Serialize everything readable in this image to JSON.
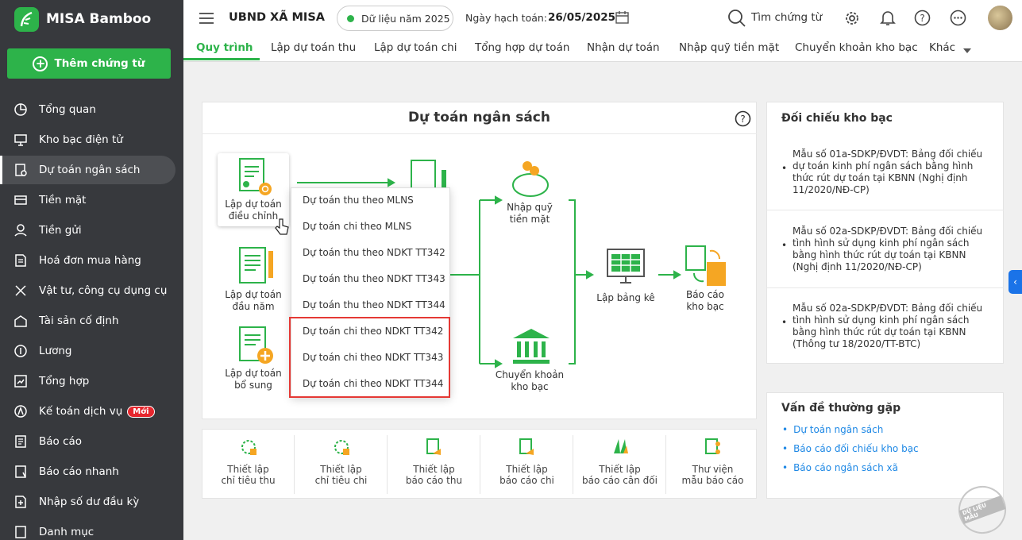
{
  "app": {
    "name": "MISA Bamboo",
    "add_label": "Thêm chứng từ"
  },
  "sidebar": {
    "items": [
      {
        "label": "Tổng quan",
        "icon": "chart-icon"
      },
      {
        "label": "Kho bạc điện tử",
        "icon": "monitor-icon"
      },
      {
        "label": "Dự toán ngân sách",
        "icon": "budget-icon",
        "active": true
      },
      {
        "label": "Tiền mặt",
        "icon": "cash-icon"
      },
      {
        "label": "Tiền gửi",
        "icon": "deposit-icon"
      },
      {
        "label": "Hoá đơn mua hàng",
        "icon": "invoice-icon"
      },
      {
        "label": "Vật tư, công cụ dụng cụ",
        "icon": "tools-icon"
      },
      {
        "label": "Tài sản cố định",
        "icon": "asset-icon"
      },
      {
        "label": "Lương",
        "icon": "salary-icon"
      },
      {
        "label": "Tổng hợp",
        "icon": "summary-icon"
      },
      {
        "label": "Kế toán dịch vụ",
        "icon": "service-icon",
        "badge": "Mới"
      },
      {
        "label": "Báo cáo",
        "icon": "report-icon"
      },
      {
        "label": "Báo cáo nhanh",
        "icon": "quick-report-icon"
      },
      {
        "label": "Nhập số dư đầu kỳ",
        "icon": "opening-balance-icon"
      },
      {
        "label": "Danh mục",
        "icon": "catalog-icon"
      }
    ]
  },
  "header": {
    "org": "UBND XÃ MISA",
    "year": "Dữ liệu năm 2025",
    "date_label": "Ngày hạch toán:",
    "date_value": "26/05/2025",
    "search": "Tìm chứng từ"
  },
  "tabs": [
    "Quy trình",
    "Lập dự toán thu",
    "Lập dự toán chi",
    "Tổng hợp dự toán",
    "Nhận dự toán",
    "Nhập quỹ tiền mặt",
    "Chuyển khoản kho bạc",
    "Khác"
  ],
  "flow": {
    "title": "Dự toán ngân sách",
    "nodes": {
      "adjust": "Lập dự toán\nđiều chỉnh",
      "start": "Lập dự toán\nđầu năm",
      "extra": "Lập dự toán\nbổ sung",
      "cash": "Nhập quỹ\ntiền mặt",
      "transfer": "Chuyển khoản\nkho bạc",
      "list": "Lập bảng kê",
      "report": "Báo cáo\nkho bạc"
    }
  },
  "dropdown": [
    "Dự toán thu theo MLNS",
    "Dự toán chi theo MLNS",
    "Dự toán thu theo NDKT TT342",
    "Dự toán thu theo NDKT TT343",
    "Dự toán thu theo NDKT TT344",
    "Dự toán chi theo NDKT TT342",
    "Dự toán chi theo NDKT TT343",
    "Dự toán chi theo NDKT TT344"
  ],
  "shortcuts": [
    "Thiết lập\nchỉ tiêu thu",
    "Thiết lập\nchỉ tiêu chi",
    "Thiết lập\nbáo cáo thu",
    "Thiết lập\nbáo cáo chi",
    "Thiết lập\nbáo cáo cân đối",
    "Thư viện\nmẫu báo cáo"
  ],
  "reconcile": {
    "title": "Đối chiếu kho bạc",
    "items": [
      "Mẫu số 01a-SDKP/ĐVDT: Bảng đối chiếu dự toán kinh phí ngân sách bằng hình thức rút dự toán tại KBNN (Nghị định 11/2020/NĐ-CP)",
      "Mẫu số 02a-SDKP/ĐVDT: Bảng đối chiếu tình hình sử dụng kinh phí ngân sách bằng hình thức rút dự toán tại KBNN (Nghị định 11/2020/NĐ-CP)",
      "Mẫu số 02a-SDKP/ĐVDT: Bảng đối chiếu tình hình sử dụng kinh phí ngân sách bằng hình thức rút dự toán tại KBNN (Thông tư 18/2020/TT-BTC)"
    ]
  },
  "issues": {
    "title": "Vấn đề thường gặp",
    "links": [
      "Dự toán ngân sách",
      "Báo cáo đối chiếu kho bạc",
      "Báo cáo ngân sách xã"
    ]
  },
  "stamp": "DỮ LIỆU MẪU",
  "colors": {
    "accent": "#2db34a",
    "sidebar": "#37393d",
    "highlight": "#e53935",
    "orange": "#f5a623"
  }
}
